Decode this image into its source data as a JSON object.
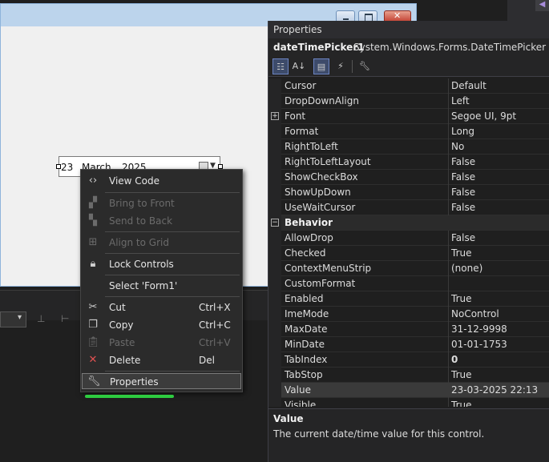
{
  "datetimepicker": {
    "day": "23",
    "month": "March",
    "year": "2025"
  },
  "context_menu": {
    "items": [
      {
        "label": "View Code",
        "shortcut": "",
        "icon": "code-icon",
        "enabled": true
      },
      {
        "label": "Bring to Front",
        "shortcut": "",
        "icon": "bring-to-front-icon",
        "enabled": false
      },
      {
        "label": "Send to Back",
        "shortcut": "",
        "icon": "send-to-back-icon",
        "enabled": false
      },
      {
        "label": "Align to Grid",
        "shortcut": "",
        "icon": "align-to-grid-icon",
        "enabled": false
      },
      {
        "label": "Lock Controls",
        "shortcut": "",
        "icon": "lock-icon",
        "enabled": true
      },
      {
        "label": "Select 'Form1'",
        "shortcut": "",
        "icon": "",
        "enabled": true
      },
      {
        "label": "Cut",
        "shortcut": "Ctrl+X",
        "icon": "scissors-icon",
        "enabled": true
      },
      {
        "label": "Copy",
        "shortcut": "Ctrl+C",
        "icon": "copy-icon",
        "enabled": true
      },
      {
        "label": "Paste",
        "shortcut": "Ctrl+V",
        "icon": "paste-icon",
        "enabled": false
      },
      {
        "label": "Delete",
        "shortcut": "Del",
        "icon": "delete-icon",
        "enabled": true
      },
      {
        "label": "Properties",
        "shortcut": "",
        "icon": "wrench-icon",
        "enabled": true
      }
    ]
  },
  "properties": {
    "title": "Properties",
    "object_name": "dateTimePicker1",
    "object_type": "System.Windows.Forms.DateTimePicker",
    "rows": [
      {
        "name": "Cursor",
        "value": "Default"
      },
      {
        "name": "DropDownAlign",
        "value": "Left"
      },
      {
        "name": "Font",
        "value": "Segoe UI, 9pt"
      },
      {
        "name": "Format",
        "value": "Long"
      },
      {
        "name": "RightToLeft",
        "value": "No"
      },
      {
        "name": "RightToLeftLayout",
        "value": "False"
      },
      {
        "name": "ShowCheckBox",
        "value": "False"
      },
      {
        "name": "ShowUpDown",
        "value": "False"
      },
      {
        "name": "UseWaitCursor",
        "value": "False"
      },
      {
        "name": "Behavior",
        "value": ""
      },
      {
        "name": "AllowDrop",
        "value": "False"
      },
      {
        "name": "Checked",
        "value": "True"
      },
      {
        "name": "ContextMenuStrip",
        "value": "(none)"
      },
      {
        "name": "CustomFormat",
        "value": ""
      },
      {
        "name": "Enabled",
        "value": "True"
      },
      {
        "name": "ImeMode",
        "value": "NoControl"
      },
      {
        "name": "MaxDate",
        "value": "31-12-9998"
      },
      {
        "name": "MinDate",
        "value": "01-01-1753"
      },
      {
        "name": "TabIndex",
        "value": "0"
      },
      {
        "name": "TabStop",
        "value": "True"
      },
      {
        "name": "Value",
        "value": "23-03-2025 22:13"
      },
      {
        "name": "Visible",
        "value": "True"
      }
    ],
    "description_title": "Value",
    "description_text": "The current date/time value for this control."
  }
}
